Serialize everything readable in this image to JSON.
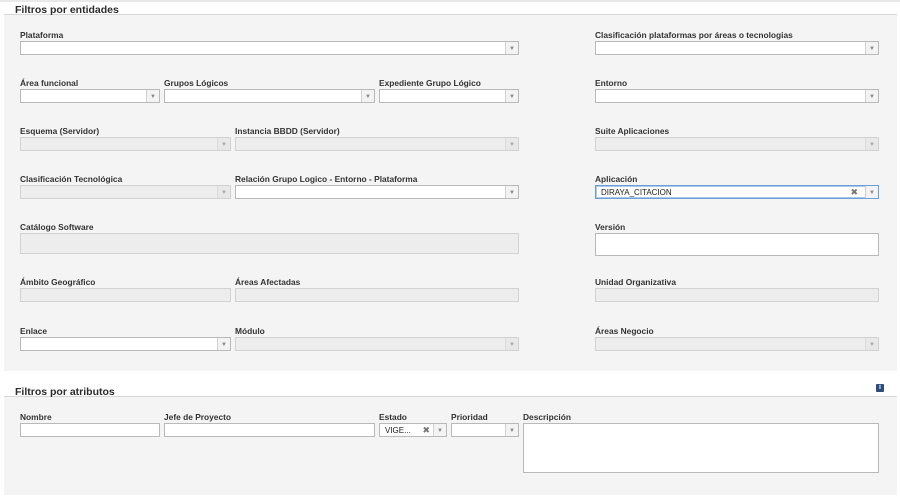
{
  "entities": {
    "title": "Filtros por entidades",
    "plataforma": "Plataforma",
    "clasificacion_plataformas": "Clasificación plataformas por áreas o tecnologias",
    "area_funcional": "Área funcional",
    "grupos_logicos": "Grupos Lógicos",
    "expediente_grupo_logico": "Expediente Grupo Lógico",
    "entorno": "Entorno",
    "esquema_servidor": "Esquema (Servidor)",
    "instancia_bbdd": "Instancia BBDD (Servidor)",
    "suite_aplicaciones": "Suite Aplicaciones",
    "clasificacion_tecnologica": "Clasificación Tecnológica",
    "relacion_grupo": "Relación Grupo Logico - Entorno - Plataforma",
    "aplicacion": "Aplicación",
    "aplicacion_value": "DIRAYA_CITACION",
    "catalogo_software": "Catálogo Software",
    "version": "Versión",
    "ambito_geografico": "Ámbito Geográfico",
    "areas_afectadas": "Áreas Afectadas",
    "unidad_organizativa": "Unidad Organizativa",
    "enlace": "Enlace",
    "modulo": "Módulo",
    "areas_negocio": "Áreas Negocio"
  },
  "attributes": {
    "title": "Filtros por atributos",
    "nombre": "Nombre",
    "jefe_proyecto": "Jefe de Proyecto",
    "estado": "Estado",
    "estado_value": "VIGE...",
    "prioridad": "Prioridad",
    "descripcion": "Descripción",
    "info_icon": "info-icon"
  },
  "glyphs": {
    "arrow": "▼",
    "clear": "✖",
    "info": "i"
  }
}
